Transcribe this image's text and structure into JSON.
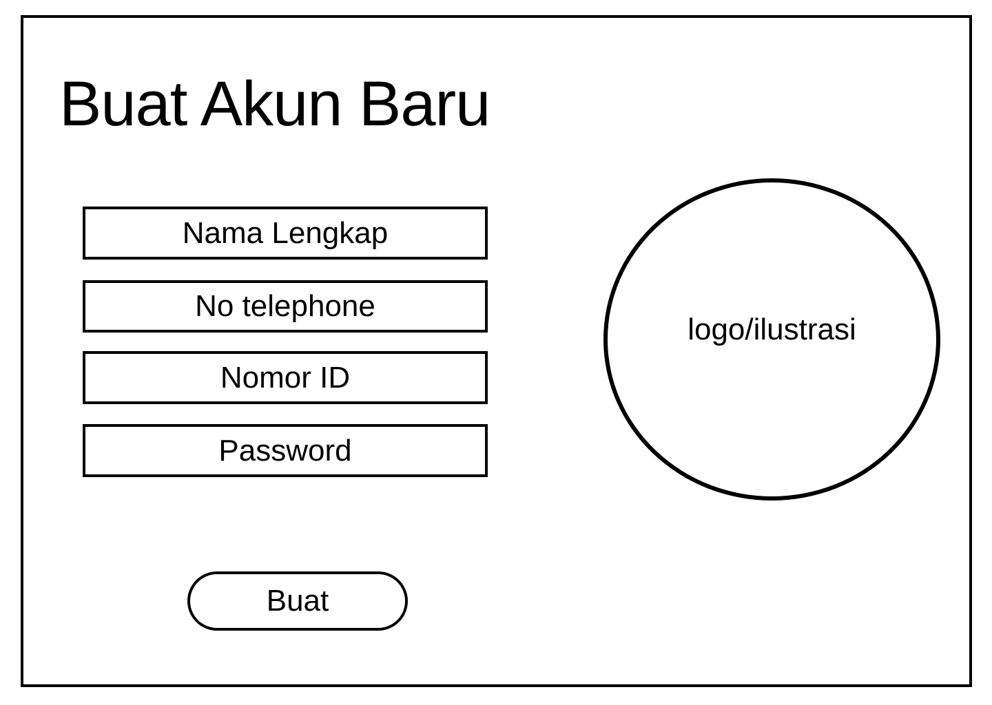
{
  "page": {
    "title": "Buat Akun Baru"
  },
  "form": {
    "fields": [
      {
        "label": "Nama Lengkap"
      },
      {
        "label": "No telephone"
      },
      {
        "label": "Nomor ID"
      },
      {
        "label": "Password"
      }
    ],
    "submit_label": "Buat"
  },
  "illustration": {
    "label": "logo/ilustrasi"
  },
  "colors": {
    "stroke": "#000000",
    "background": "#ffffff"
  }
}
